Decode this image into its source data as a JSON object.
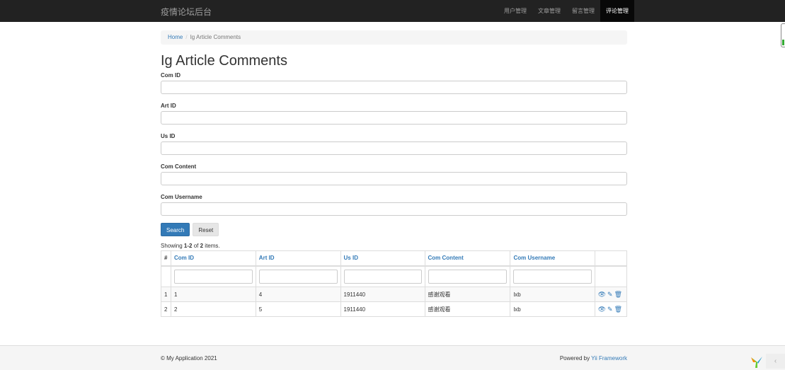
{
  "navbar": {
    "brand": "疫情论坛后台",
    "items": [
      {
        "label": "用户管理",
        "active": false
      },
      {
        "label": "文章管理",
        "active": false
      },
      {
        "label": "留言管理",
        "active": false
      },
      {
        "label": "评论管理",
        "active": true
      }
    ]
  },
  "breadcrumb": {
    "home": "Home",
    "separator": "/",
    "current": "Ig Article Comments"
  },
  "page_title": "Ig Article Comments",
  "search_form": {
    "fields": [
      {
        "label": "Com ID",
        "value": ""
      },
      {
        "label": "Art ID",
        "value": ""
      },
      {
        "label": "Us ID",
        "value": ""
      },
      {
        "label": "Com Content",
        "value": ""
      },
      {
        "label": "Com Username",
        "value": ""
      }
    ],
    "search_label": "Search",
    "reset_label": "Reset"
  },
  "summary": {
    "prefix": "Showing ",
    "range": "1-2",
    "middle": " of ",
    "total": "2",
    "suffix": " items."
  },
  "grid": {
    "columns": [
      "#",
      "Com ID",
      "Art ID",
      "Us ID",
      "Com Content",
      "Com Username"
    ],
    "rows": [
      {
        "num": "1",
        "com_id": "1",
        "art_id": "4",
        "us_id": "1911440",
        "content": "感谢观看",
        "username": "lxb"
      },
      {
        "num": "2",
        "com_id": "2",
        "art_id": "5",
        "us_id": "1911440",
        "content": "感谢观看",
        "username": "lxb"
      }
    ],
    "action_icons": [
      "eye-icon",
      "pencil-icon",
      "trash-icon"
    ]
  },
  "footer": {
    "copyright": "© My Application 2021",
    "powered_prefix": "Powered by ",
    "powered_link": "Yii Framework"
  },
  "colors": {
    "navbar": "#222222",
    "link": "#337ab7",
    "primary": "#337ab7"
  }
}
